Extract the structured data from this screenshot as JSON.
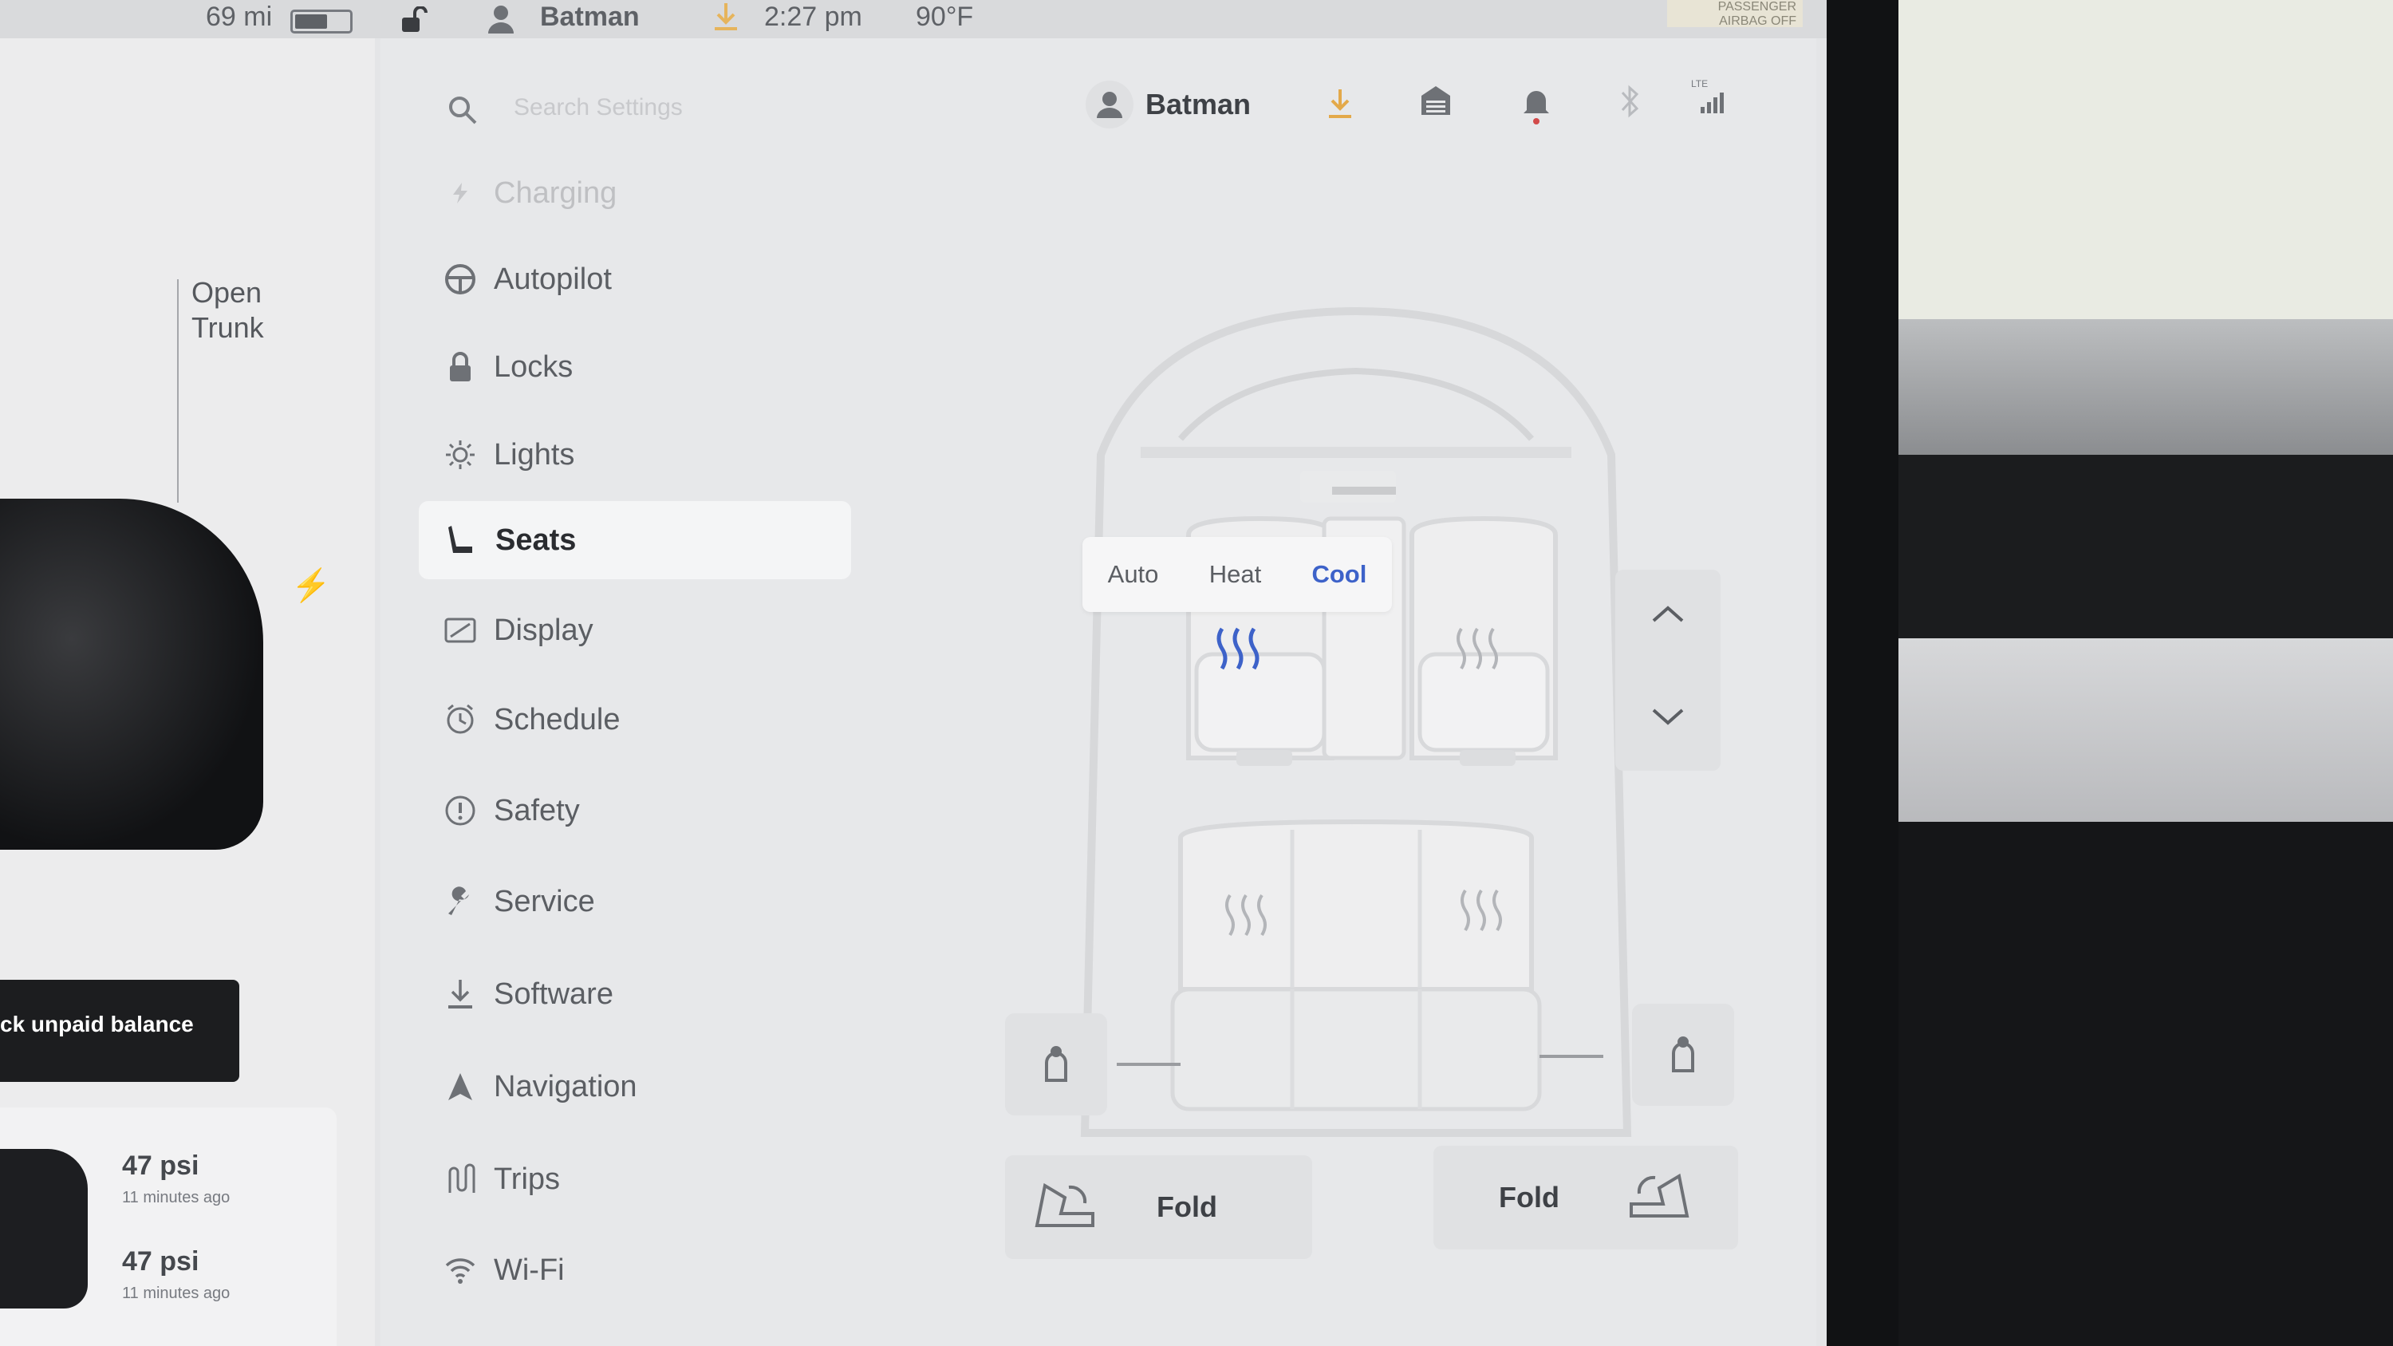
{
  "status_bar": {
    "range": "69 mi",
    "battery_level": 0.6,
    "user": "Batman",
    "time": "2:27 pm",
    "temperature": "90°F",
    "airbag_label": "PASSENGER AIRBAG OFF"
  },
  "car_panel": {
    "open_trunk": "Open\nTrunk",
    "toast": "ck unpaid balance",
    "tires": [
      {
        "psi": "47 psi",
        "ago": "11 minutes ago"
      },
      {
        "psi": "47 psi",
        "ago": "11 minutes ago"
      }
    ]
  },
  "header": {
    "search_placeholder": "Search Settings",
    "user": "Batman",
    "icons": [
      "download-icon",
      "garage-icon",
      "bell-icon",
      "bluetooth-icon",
      "lte-signal-icon"
    ],
    "lte_label": "LTE"
  },
  "menu": {
    "items": [
      {
        "label": "Charging",
        "icon": "charging-icon"
      },
      {
        "label": "Autopilot",
        "icon": "steering-wheel-icon"
      },
      {
        "label": "Locks",
        "icon": "lock-icon"
      },
      {
        "label": "Lights",
        "icon": "light-icon"
      },
      {
        "label": "Seats",
        "icon": "seat-icon"
      },
      {
        "label": "Display",
        "icon": "display-icon"
      },
      {
        "label": "Schedule",
        "icon": "schedule-icon"
      },
      {
        "label": "Safety",
        "icon": "safety-icon"
      },
      {
        "label": "Service",
        "icon": "wrench-icon"
      },
      {
        "label": "Software",
        "icon": "download-icon"
      },
      {
        "label": "Navigation",
        "icon": "navigation-icon"
      },
      {
        "label": "Trips",
        "icon": "trips-icon"
      },
      {
        "label": "Wi-Fi",
        "icon": "wifi-icon"
      }
    ],
    "active": "Seats"
  },
  "seats": {
    "modes": [
      "Auto",
      "Heat",
      "Cool"
    ],
    "selected_mode": "Cool",
    "fold_left": "Fold",
    "fold_right": "Fold",
    "accent_color": "#3d62c9"
  }
}
